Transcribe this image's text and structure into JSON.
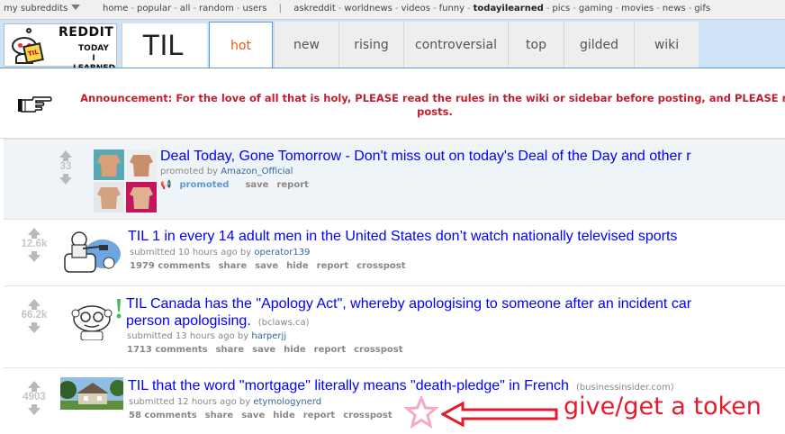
{
  "srbar": {
    "my_subreddits": "my subreddits",
    "left_links": [
      "home",
      "popular",
      "all",
      "random",
      "users"
    ],
    "sep": "|",
    "right_links": [
      "askreddit",
      "worldnews",
      "videos",
      "funny",
      "todayilearned",
      "pics",
      "gaming",
      "movies",
      "news",
      "gifs"
    ],
    "active": "todayilearned"
  },
  "header": {
    "logo_top": "REDDIT",
    "logo_bottom_1": "TODAY",
    "logo_bottom_2": "I LEARNED",
    "logo_sign": "TIL",
    "page_name": "TIL",
    "tabs": [
      "hot",
      "new",
      "rising",
      "controversial",
      "top",
      "gilded",
      "wiki"
    ],
    "selected_tab": "hot"
  },
  "announcement": {
    "line1": "Announcement: For the love of all that is holy, PLEASE read the rules in the wiki or sidebar before posting, and PLEASE n",
    "line2": "posts."
  },
  "posts": [
    {
      "score": "33",
      "title": "Deal Today, Gone Tomorrow - Don't miss out on today's Deal of the Day and other r",
      "tagline_prefix": "promoted by ",
      "author": "Amazon_Official",
      "buttons": [
        "promoted",
        "save",
        "report"
      ]
    },
    {
      "score": "12.6k",
      "title": "TIL 1 in every 14 adult men in the United States don’t watch nationally televised sports",
      "tagline_prefix": "submitted 10 hours ago by ",
      "author": "operator139",
      "buttons": [
        "1979 comments",
        "share",
        "save",
        "hide",
        "report",
        "crosspost"
      ]
    },
    {
      "score": "66.2k",
      "title": "TIL Canada has the \"Apology Act\", whereby apologising to someone after an incident car",
      "title_line2": "person apologising.",
      "domain": "(bclaws.ca)",
      "tagline_prefix": "submitted 13 hours ago by ",
      "author": "harperjj",
      "buttons": [
        "1713 comments",
        "share",
        "save",
        "hide",
        "report",
        "crosspost"
      ]
    },
    {
      "score": "4903",
      "title": "TIL that the word \"mortgage\" literally means \"death-pledge\" in French",
      "domain": "(businessinsider.com)",
      "tagline_prefix": "submitted 12 hours ago by ",
      "author": "etymologynerd",
      "buttons": [
        "58 comments",
        "share",
        "save",
        "hide",
        "report",
        "crosspost"
      ]
    }
  ],
  "annotation": {
    "text": "give/get a token",
    "color": "#e51a2e",
    "star_color": "#f7a8c8"
  },
  "colors": {
    "header_bg": "#cee3f8",
    "selected_tab": "#e05a19",
    "link_blue": "#0000ff",
    "announcement_red": "#c01f2e"
  }
}
